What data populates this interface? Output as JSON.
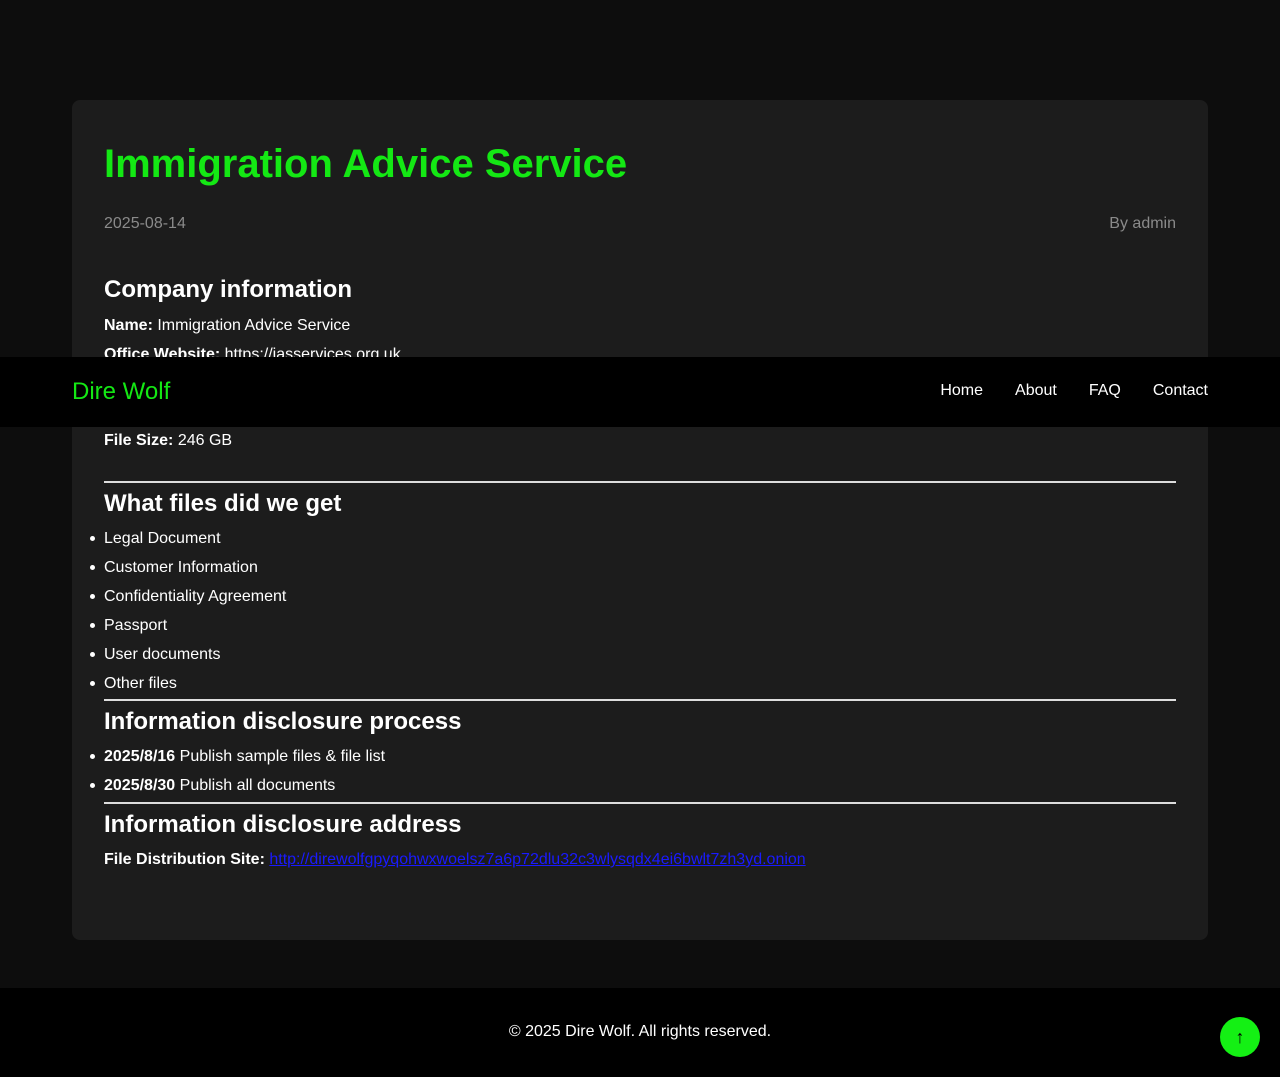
{
  "post": {
    "title": "Immigration Advice Service",
    "date": "2025-08-14",
    "author": "By admin"
  },
  "company": {
    "heading": "Company information",
    "name_label": "Name:",
    "name_value": "Immigration Advice Service",
    "website_label": "Office Website:",
    "website_value": "https://iasservices.org.uk",
    "filesize_label": "File Size:",
    "filesize_value": "246 GB"
  },
  "files": {
    "heading": "What files did we get",
    "items": [
      "Legal Document",
      "Customer Information",
      "Confidentiality Agreement",
      "Passport",
      "User documents",
      "Other files"
    ]
  },
  "process": {
    "heading": "Information disclosure process",
    "items": [
      {
        "date": "2025/8/16",
        "text": "Publish sample files & file list"
      },
      {
        "date": "2025/8/30",
        "text": "Publish all documents"
      }
    ]
  },
  "address": {
    "heading": "Information disclosure address",
    "label": "File Distribution Site:",
    "url": "http://direwolfgpyqohwxwoelsz7a6p72dlu32c3wlysqdx4ei6bwlt7zh3yd.onion"
  },
  "navbar": {
    "brand": "Dire Wolf",
    "links": [
      "Home",
      "About",
      "FAQ",
      "Contact"
    ]
  },
  "footer": {
    "text": "© 2025 Dire Wolf. All rights reserved."
  },
  "back_to_top": {
    "icon": "arrow-up-icon",
    "glyph": "↑"
  },
  "colors": {
    "accent": "#14e814",
    "card_bg": "#1c1c1c",
    "page_bg": "#0d0d0d",
    "link": "#1a1aff"
  }
}
